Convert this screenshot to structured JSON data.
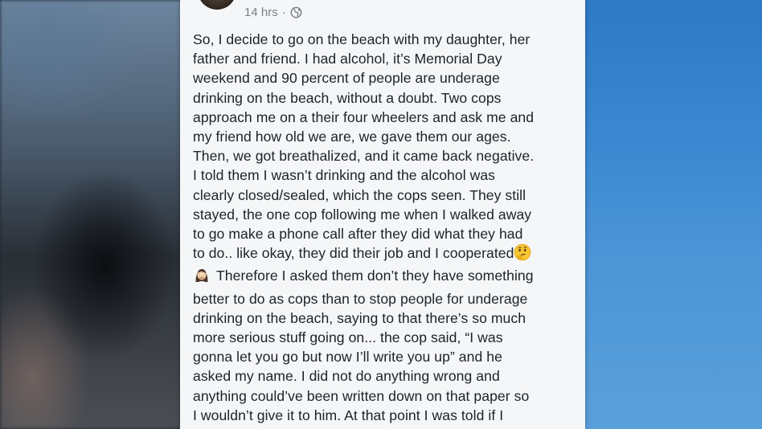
{
  "post": {
    "timestamp": "14 hrs",
    "separator": "·",
    "privacy_icon": "globe-icon",
    "lines": [
      "So, I decide to go on the beach with my daughter, her",
      "father and friend. I had alcohol, it’s Memorial Day",
      "weekend and 90 percent of people are underage",
      "drinking on the beach, without a doubt. Two cops",
      "approach me on a their four wheelers and ask me and",
      "my friend how old we are, we gave them our ages.",
      "Then, we got breathalized, and it came back negative.",
      "I told them I wasn’t drinking and the alcohol was",
      "clearly closed/sealed, which the cops seen. They still",
      "stayed, the one cop following me when I walked away",
      "to go make a phone call after they did what they had",
      "to do.. like okay, they did their job and I cooperated",
      "Therefore I asked them don’t they have something",
      "better to do as cops than to stop people for underage",
      "drinking on the beach, saying to that there’s so much",
      "more serious stuff going on... the cop said, “I was",
      "gonna let you go but now I’ll write you up” and he",
      "asked my name. I did not do anything wrong and",
      "anything could’ve been written down on that paper so",
      "I wouldn’t give it to him. At that point I was told if I"
    ],
    "emojis": [
      "thinking-face-icon",
      "woman-facepalming-icon"
    ]
  },
  "colors": {
    "card_bg": "#f5f6f7",
    "text": "#1d2129",
    "meta_text": "#7b7f86",
    "right_bg": "#3a86d0"
  }
}
